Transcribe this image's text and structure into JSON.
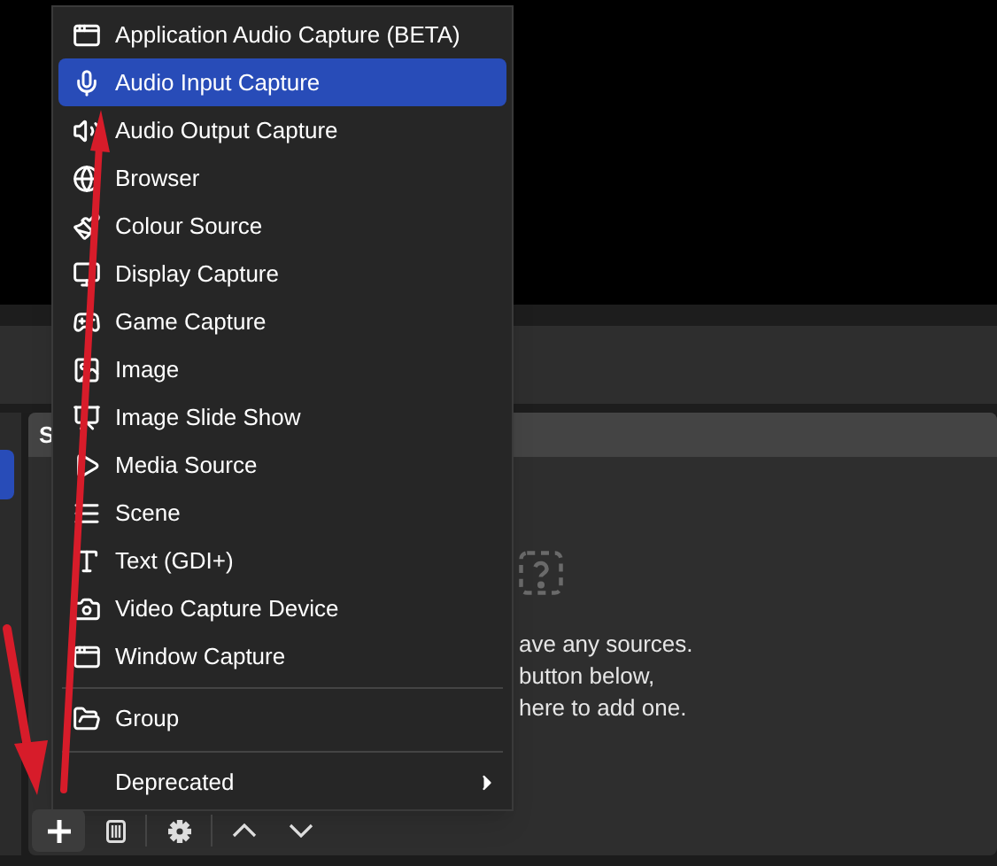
{
  "scenes_dock": {
    "items": [
      {
        "selected": true
      }
    ]
  },
  "sources_dock": {
    "title": "S",
    "empty_message": [
      "ave any sources.",
      "button below,",
      "here to add one."
    ]
  },
  "context_menu": {
    "items": [
      {
        "kind": "item",
        "label": "Application Audio Capture (BETA)",
        "selected": false
      },
      {
        "kind": "item",
        "label": "Audio Input Capture",
        "selected": true
      },
      {
        "kind": "item",
        "label": "Audio Output Capture",
        "selected": false
      },
      {
        "kind": "item",
        "label": "Browser",
        "selected": false
      },
      {
        "kind": "item",
        "label": "Colour Source",
        "selected": false
      },
      {
        "kind": "item",
        "label": "Display Capture",
        "selected": false
      },
      {
        "kind": "item",
        "label": "Game Capture",
        "selected": false
      },
      {
        "kind": "item",
        "label": "Image",
        "selected": false
      },
      {
        "kind": "item",
        "label": "Image Slide Show",
        "selected": false
      },
      {
        "kind": "item",
        "label": "Media Source",
        "selected": false
      },
      {
        "kind": "item",
        "label": "Scene",
        "selected": false
      },
      {
        "kind": "item",
        "label": "Text (GDI+)",
        "selected": false
      },
      {
        "kind": "item",
        "label": "Video Capture Device",
        "selected": false
      },
      {
        "kind": "item",
        "label": "Window Capture",
        "selected": false
      },
      {
        "kind": "separator"
      },
      {
        "kind": "item",
        "label": "Group",
        "selected": false
      },
      {
        "kind": "separator"
      },
      {
        "kind": "submenu",
        "label": "Deprecated",
        "selected": false
      }
    ]
  }
}
